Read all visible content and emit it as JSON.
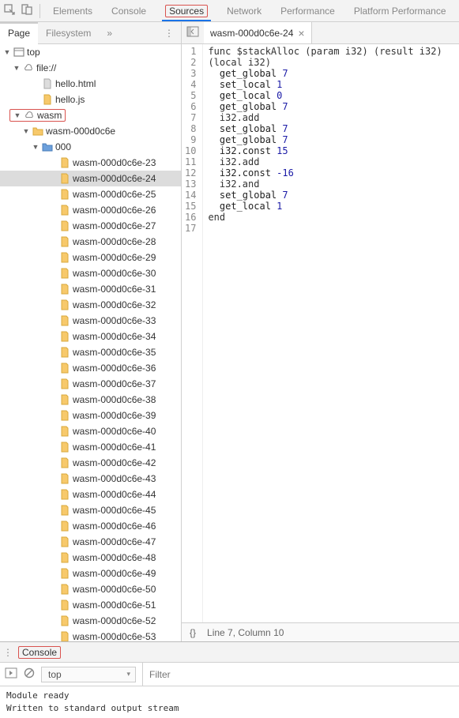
{
  "top_tabs": {
    "elements": "Elements",
    "console": "Console",
    "sources": "Sources",
    "network": "Network",
    "performance": "Performance",
    "platform_performance": "Platform Performance"
  },
  "sec_tabs": {
    "page": "Page",
    "filesystem": "Filesystem",
    "more": "»"
  },
  "open_file": {
    "name": "wasm-000d0c6e-24",
    "close": "×"
  },
  "tree": {
    "top": "top",
    "file_scheme": "file://",
    "hello_html": "hello.html",
    "hello_js": "hello.js",
    "wasm": "wasm",
    "wasm_root": "wasm-000d0c6e",
    "folder000": "000",
    "items": [
      "wasm-000d0c6e-23",
      "wasm-000d0c6e-24",
      "wasm-000d0c6e-25",
      "wasm-000d0c6e-26",
      "wasm-000d0c6e-27",
      "wasm-000d0c6e-28",
      "wasm-000d0c6e-29",
      "wasm-000d0c6e-30",
      "wasm-000d0c6e-31",
      "wasm-000d0c6e-32",
      "wasm-000d0c6e-33",
      "wasm-000d0c6e-34",
      "wasm-000d0c6e-35",
      "wasm-000d0c6e-36",
      "wasm-000d0c6e-37",
      "wasm-000d0c6e-38",
      "wasm-000d0c6e-39",
      "wasm-000d0c6e-40",
      "wasm-000d0c6e-41",
      "wasm-000d0c6e-42",
      "wasm-000d0c6e-43",
      "wasm-000d0c6e-44",
      "wasm-000d0c6e-45",
      "wasm-000d0c6e-46",
      "wasm-000d0c6e-47",
      "wasm-000d0c6e-48",
      "wasm-000d0c6e-49",
      "wasm-000d0c6e-50",
      "wasm-000d0c6e-51",
      "wasm-000d0c6e-52",
      "wasm-000d0c6e-53"
    ]
  },
  "code": {
    "lines": [
      {
        "n": 1,
        "t": "func $stackAlloc (param i32) (result i32)"
      },
      {
        "n": 2,
        "t": "(local i32)"
      },
      {
        "n": 3,
        "t": "  get_global ",
        "v": "7"
      },
      {
        "n": 4,
        "t": "  set_local ",
        "v": "1"
      },
      {
        "n": 5,
        "t": "  get_local ",
        "v": "0"
      },
      {
        "n": 6,
        "t": "  get_global ",
        "v": "7"
      },
      {
        "n": 7,
        "t": "  i32.add"
      },
      {
        "n": 8,
        "t": "  set_global ",
        "v": "7"
      },
      {
        "n": 9,
        "t": "  get_global ",
        "v": "7"
      },
      {
        "n": 10,
        "t": "  i32.const ",
        "v": "15"
      },
      {
        "n": 11,
        "t": "  i32.add"
      },
      {
        "n": 12,
        "t": "  i32.const ",
        "v": "-16"
      },
      {
        "n": 13,
        "t": "  i32.and"
      },
      {
        "n": 14,
        "t": "  set_global ",
        "v": "7"
      },
      {
        "n": 15,
        "t": "  get_local ",
        "v": "1"
      },
      {
        "n": 16,
        "t": "end"
      },
      {
        "n": 17,
        "t": ""
      }
    ]
  },
  "status": {
    "braces": "{}",
    "cursor": "Line 7, Column 10"
  },
  "drawer": {
    "console_tab": "Console",
    "context": "top",
    "filter_placeholder": "Filter",
    "messages": [
      "Module ready",
      "Written to standard output stream"
    ]
  }
}
